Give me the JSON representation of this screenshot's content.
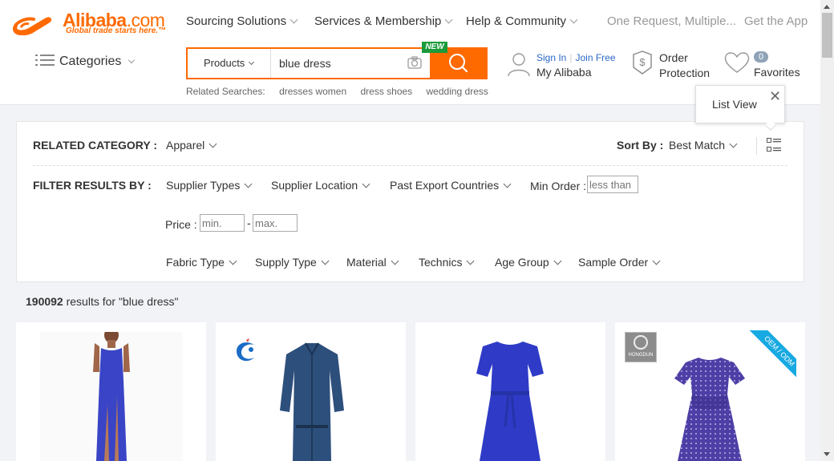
{
  "header": {
    "logo": {
      "brand": "Alibaba",
      "suffix": ".com",
      "tagline": "Global trade starts here.™"
    },
    "topnav": [
      {
        "label": "Sourcing Solutions"
      },
      {
        "label": "Services & Membership"
      },
      {
        "label": "Help & Community"
      },
      {
        "label": "One Request, Multiple..."
      },
      {
        "label": "Get the App"
      }
    ],
    "categories_label": "Categories",
    "search": {
      "category": "Products",
      "value": "blue dress",
      "new_badge": "NEW"
    },
    "related": {
      "label": "Related Searches:",
      "items": [
        "dresses women",
        "dress shoes",
        "wedding dress"
      ]
    },
    "account": {
      "sign_in": "Sign In",
      "join_free": "Join Free",
      "my_alibaba": "My Alibaba"
    },
    "order_protection": {
      "line1": "Order",
      "line2": "Protection"
    },
    "favorites": {
      "count": "0",
      "label": "Favorites"
    }
  },
  "filters": {
    "related_category_label": "RELATED CATEGORY :",
    "related_category_value": "Apparel",
    "sort_label": "Sort By :",
    "sort_value": "Best Match",
    "tooltip": "List View",
    "filter_label": "FILTER RESULTS BY :",
    "row1": [
      "Supplier Types",
      "Supplier Location",
      "Past Export Countries"
    ],
    "min_order_label": "Min Order :",
    "min_order_placeholder": "less than",
    "price_label": "Price :",
    "price_min_placeholder": "min.",
    "price_max_placeholder": "max.",
    "price_sep": "-",
    "row3": [
      "Fabric Type",
      "Supply Type",
      "Material",
      "Technics",
      "Age Group",
      "Sample Order"
    ]
  },
  "results": {
    "count": "190092",
    "text": " results for \"blue dress\""
  },
  "cards": [
    {
      "supplier_badge": ""
    },
    {
      "supplier_badge": ""
    },
    {
      "supplier_badge": ""
    },
    {
      "supplier_badge": "HONGDUN",
      "ribbon": "OEM / ODM"
    }
  ],
  "colors": {
    "accent": "#ff6a00",
    "link": "#2b67c7",
    "new_badge": "#1a9a3a",
    "dress_blue": "#3340c4",
    "denim": "#2d4f7c",
    "ribbon": "#17a9e1"
  }
}
